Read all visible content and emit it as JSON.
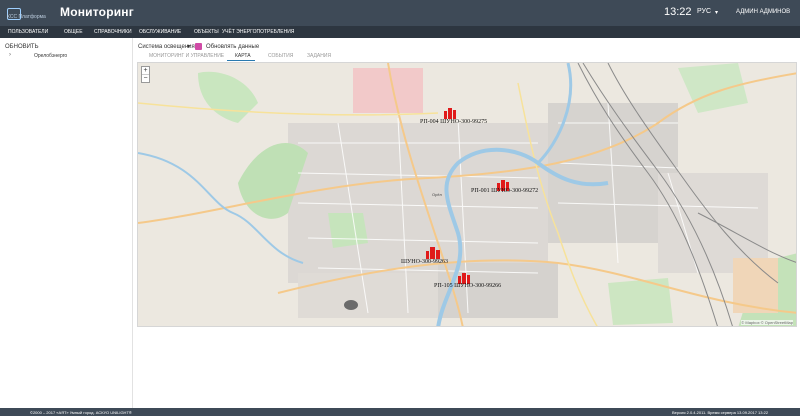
{
  "header": {
    "logo_text": "КСС Платформа",
    "title": "Мониторинг",
    "time": "13:22",
    "lang": "РУС",
    "user": "АДМИН АДМИНОВ"
  },
  "nav": [
    {
      "label": "Пользователи"
    },
    {
      "label": "Общее"
    },
    {
      "label": "Справочники"
    },
    {
      "label": "Обслуживание"
    },
    {
      "label": "Объекты"
    },
    {
      "label": "Учёт энергопотребления"
    }
  ],
  "sidebar": {
    "refresh_label": "ОБНОВИТЬ",
    "tree_item": "Орелобэнерго"
  },
  "toolbar": {
    "system_select": "Система освещения",
    "auto_refresh_label": "Обновлять данные",
    "auto_refresh_checked": true
  },
  "tabs": [
    {
      "label": "МОНИТОРИНГ И УПРАВЛЕНИЕ",
      "active": false
    },
    {
      "label": "КАРТА",
      "active": true
    },
    {
      "label": "СОБЫТИЯ",
      "active": false
    },
    {
      "label": "ЗАДАНИЯ",
      "active": false
    }
  ],
  "map": {
    "zoom_in": "+",
    "zoom_out": "−",
    "attribution": "© Mapbox © OpenStreetMap",
    "place_label": "Орёл",
    "markers": [
      {
        "label": "РП-004 ШУНО-300-99275"
      },
      {
        "label": "РП-001 ШУНО-300-99272"
      },
      {
        "label": "ШУНО-300-99263"
      },
      {
        "label": "РП-105 ШУНО-300-99266"
      }
    ],
    "marker_color": "#e01a1a"
  },
  "footer": {
    "left": "©2000 – 2017 «АЯТ» Умный город. АСКУО UNILIGHT®",
    "right": "Версия 2.0.4.2011. Время сервера 13.09.2017 13:22"
  }
}
